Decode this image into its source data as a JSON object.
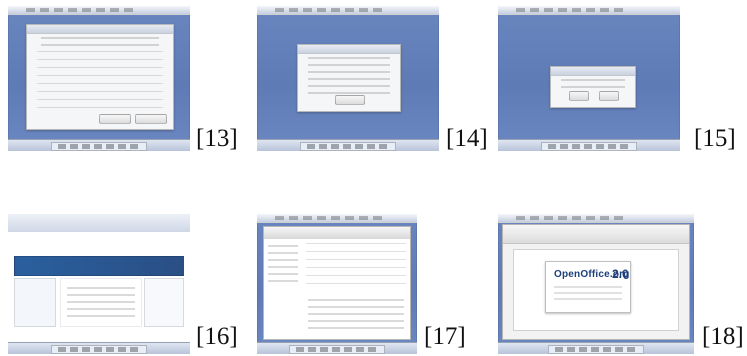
{
  "panels": [
    {
      "label": "[13]"
    },
    {
      "label": "[14]"
    },
    {
      "label": "[15]"
    },
    {
      "label": "[16]"
    },
    {
      "label": "[17]"
    },
    {
      "label": "[18]"
    }
  ],
  "office_splash": {
    "product": "OpenOffice.org",
    "version": "2.0"
  }
}
